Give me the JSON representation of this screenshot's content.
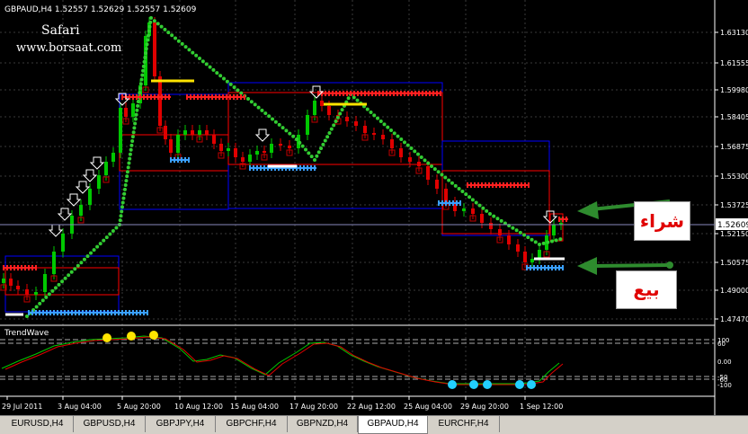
{
  "header": {
    "symbol_info": "GBPAUD,H4  1.52557 1.52629 1.52557 1.52609"
  },
  "watermark": {
    "line1": "Safari",
    "line2": "www.borsaat.com"
  },
  "price_axis": {
    "ticks": [
      "1.63130",
      "1.61555",
      "1.59980",
      "1.58405",
      "1.56875",
      "1.55300",
      "1.53725",
      "1.52150",
      "1.50575",
      "1.49000",
      "1.47470"
    ],
    "current_price": "1.52609"
  },
  "indicator": {
    "name": "TrendWave",
    "levels": [
      "100",
      "60",
      "0.00",
      "-50",
      "-60",
      "-100"
    ]
  },
  "time_axis": {
    "ticks": [
      "29 Jul 2011",
      "3 Aug 04:00",
      "5 Aug 20:00",
      "10 Aug 12:00",
      "15 Aug 04:00",
      "17 Aug 20:00",
      "22 Aug 12:00",
      "25 Aug 04:00",
      "29 Aug 20:00",
      "1 Sep 12:00"
    ]
  },
  "annotations": {
    "buy_label": "شراء",
    "sell_label": "بيع"
  },
  "colors": {
    "bull": "#00c800",
    "bear": "#e00000",
    "trend_dots": "#32cd32",
    "blue_box": "#0000ff",
    "red_box": "#ff0000",
    "buy_marks": "#3aa0ff",
    "sell_marks": "#ff2020",
    "axis_text": "#ffffff"
  },
  "tabs": [
    {
      "label": "EURUSD,H4",
      "active": false
    },
    {
      "label": "GBPUSD,H4",
      "active": false
    },
    {
      "label": "GBPJPY,H4",
      "active": false
    },
    {
      "label": "GBPCHF,H4",
      "active": false
    },
    {
      "label": "GBPNZD,H4",
      "active": false
    },
    {
      "label": "GBPAUD,H4",
      "active": true
    },
    {
      "label": "EURCHF,H4",
      "active": false
    }
  ]
}
